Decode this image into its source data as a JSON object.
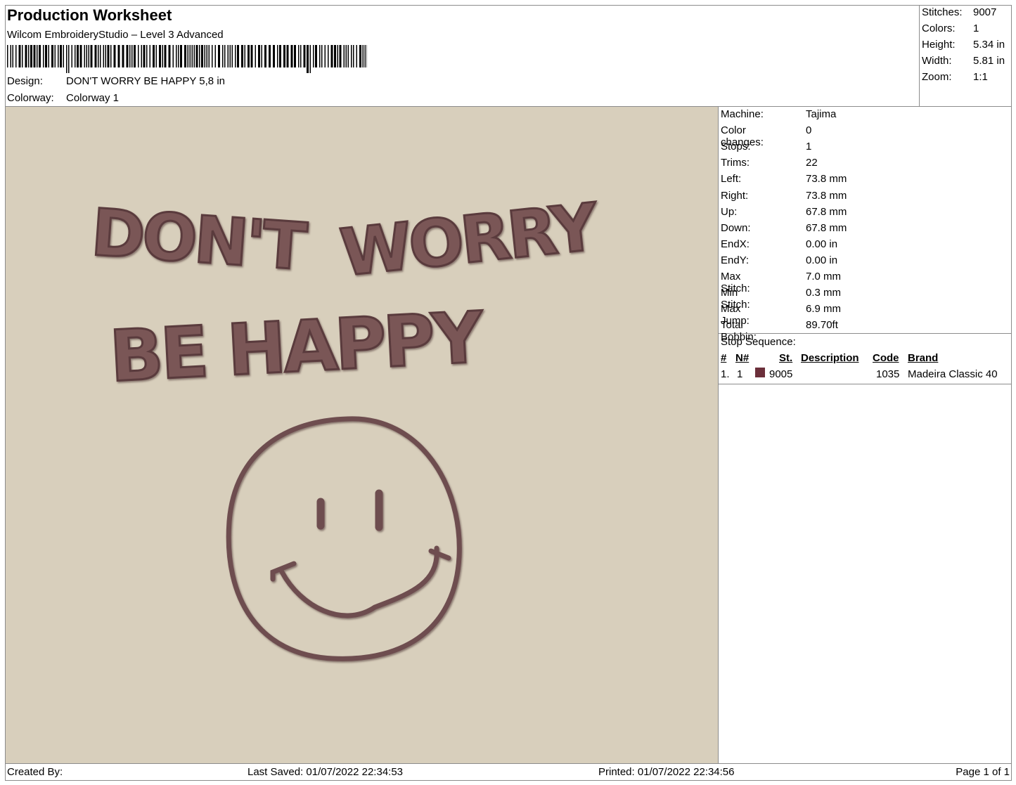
{
  "header": {
    "title": "Production Worksheet",
    "subtitle": "Wilcom EmbroideryStudio – Level 3 Advanced",
    "barcode_text": "|||||||||||'||||||||||||||||||||||||||||||||||||||||,|||||||||",
    "design_label": "Design:",
    "design_value": "DON'T WORRY BE HAPPY 5,8 in",
    "colorway_label": "Colorway:",
    "colorway_value": "Colorway 1"
  },
  "summary": {
    "stitches_label": "Stitches:",
    "stitches_value": "9007",
    "colors_label": "Colors:",
    "colors_value": "1",
    "height_label": "Height:",
    "height_value": "5.34 in",
    "width_label": "Width:",
    "width_value": "5.81 in",
    "zoom_label": "Zoom:",
    "zoom_value": "1:1"
  },
  "design": {
    "line1a": "DON'T",
    "line1b": "WORRY",
    "line2": "BE HAPPY",
    "thread_color": "#6e4d4f",
    "background_color": "#d8cfbc"
  },
  "details": [
    {
      "label": "Machine:",
      "value": "Tajima"
    },
    {
      "label": "Color changes:",
      "value": "0"
    },
    {
      "label": "Stops:",
      "value": "1"
    },
    {
      "label": "Trims:",
      "value": "22"
    },
    {
      "label": "Left:",
      "value": "73.8 mm"
    },
    {
      "label": "Right:",
      "value": "73.8 mm"
    },
    {
      "label": "Up:",
      "value": "67.8 mm"
    },
    {
      "label": "Down:",
      "value": "67.8 mm"
    },
    {
      "label": "EndX:",
      "value": "0.00 in"
    },
    {
      "label": "EndY:",
      "value": "0.00 in"
    },
    {
      "label": "Max Stitch:",
      "value": "7.0 mm"
    },
    {
      "label": "Min Stitch:",
      "value": "0.3 mm"
    },
    {
      "label": "Max Jump:",
      "value": "6.9 mm"
    },
    {
      "label": "Total Bobbin:",
      "value": "89.70ft"
    }
  ],
  "stop_sequence": {
    "title": "Stop Sequence:",
    "headers": {
      "num": "#",
      "n": "N#",
      "st": "St.",
      "description": "Description",
      "code": "Code",
      "brand": "Brand"
    },
    "rows": [
      {
        "num": "1.",
        "n": "1",
        "swatch_color": "#6b2f3a",
        "st": "9005",
        "description": "",
        "code": "1035",
        "brand": "Madeira Classic 40"
      }
    ]
  },
  "footer": {
    "created_by": "Created By:",
    "last_saved": "Last Saved: 01/07/2022 22:34:53",
    "printed": "Printed: 01/07/2022 22:34:56",
    "page": "Page 1 of 1"
  }
}
